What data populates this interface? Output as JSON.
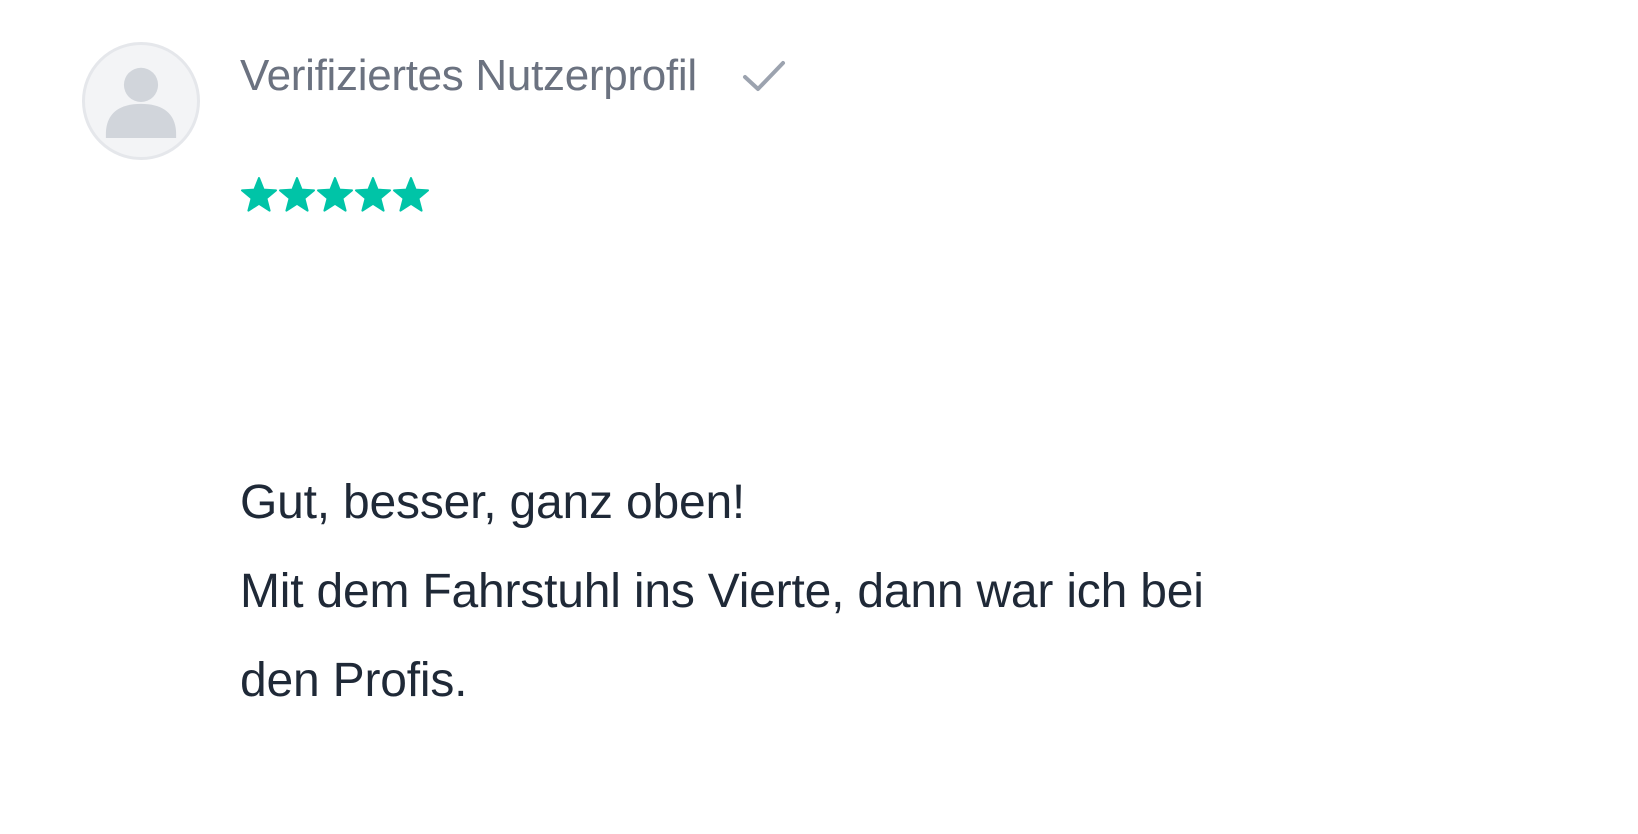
{
  "review": {
    "author": {
      "name": "Verifiziertes Nutzerprofil",
      "avatar_icon": "user-avatar-placeholder-icon",
      "verified_icon": "checkmark-icon"
    },
    "rating": {
      "stars": 5,
      "max_stars": 5,
      "color": "#00c4a7",
      "star_icon": "star-icon"
    },
    "text_lines": [
      "Gut, besser, ganz oben!",
      "Mit dem Fahrstuhl ins Vierte, dann war ich bei",
      "den Profis."
    ]
  },
  "colors": {
    "author_text": "#6b7280",
    "body_text": "#1f2937",
    "avatar_bg": "#f3f4f6",
    "avatar_figure": "#d1d5db",
    "check": "#9ca3af"
  }
}
